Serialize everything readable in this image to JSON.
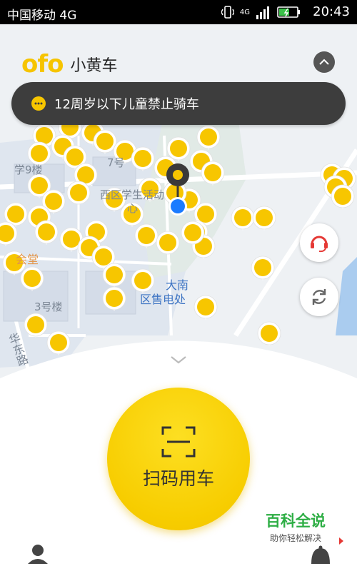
{
  "status_bar": {
    "carrier": "中国移动 4G",
    "time": "20:43",
    "network": "4G"
  },
  "header": {
    "logo": "ofo",
    "title": "小黄车"
  },
  "notice": {
    "text": "12周岁以下儿童禁止骑车"
  },
  "map": {
    "labels": {
      "building9": "学9楼",
      "building7": "7号",
      "student": "西区学生活动",
      "center": "心",
      "hall": "会堂",
      "building3": "3号楼",
      "electric_line1": "大南",
      "electric_line2": "区售电处",
      "road": "华东路"
    }
  },
  "action": {
    "scan_label": "扫码用车"
  },
  "watermark": {
    "title": "百科全说",
    "subtitle": "助你轻松解决"
  },
  "colors": {
    "brand_yellow": "#f7c600",
    "notice_bg": "#3d3d3d",
    "location_blue": "#1a7bff",
    "support_red": "#e53935"
  },
  "icons": [
    "signal-icon",
    "battery-icon",
    "collapse-icon",
    "message-icon",
    "location-pin-icon",
    "support-icon",
    "refresh-icon",
    "scan-icon",
    "chevron-down-icon",
    "user-icon",
    "bell-icon"
  ]
}
